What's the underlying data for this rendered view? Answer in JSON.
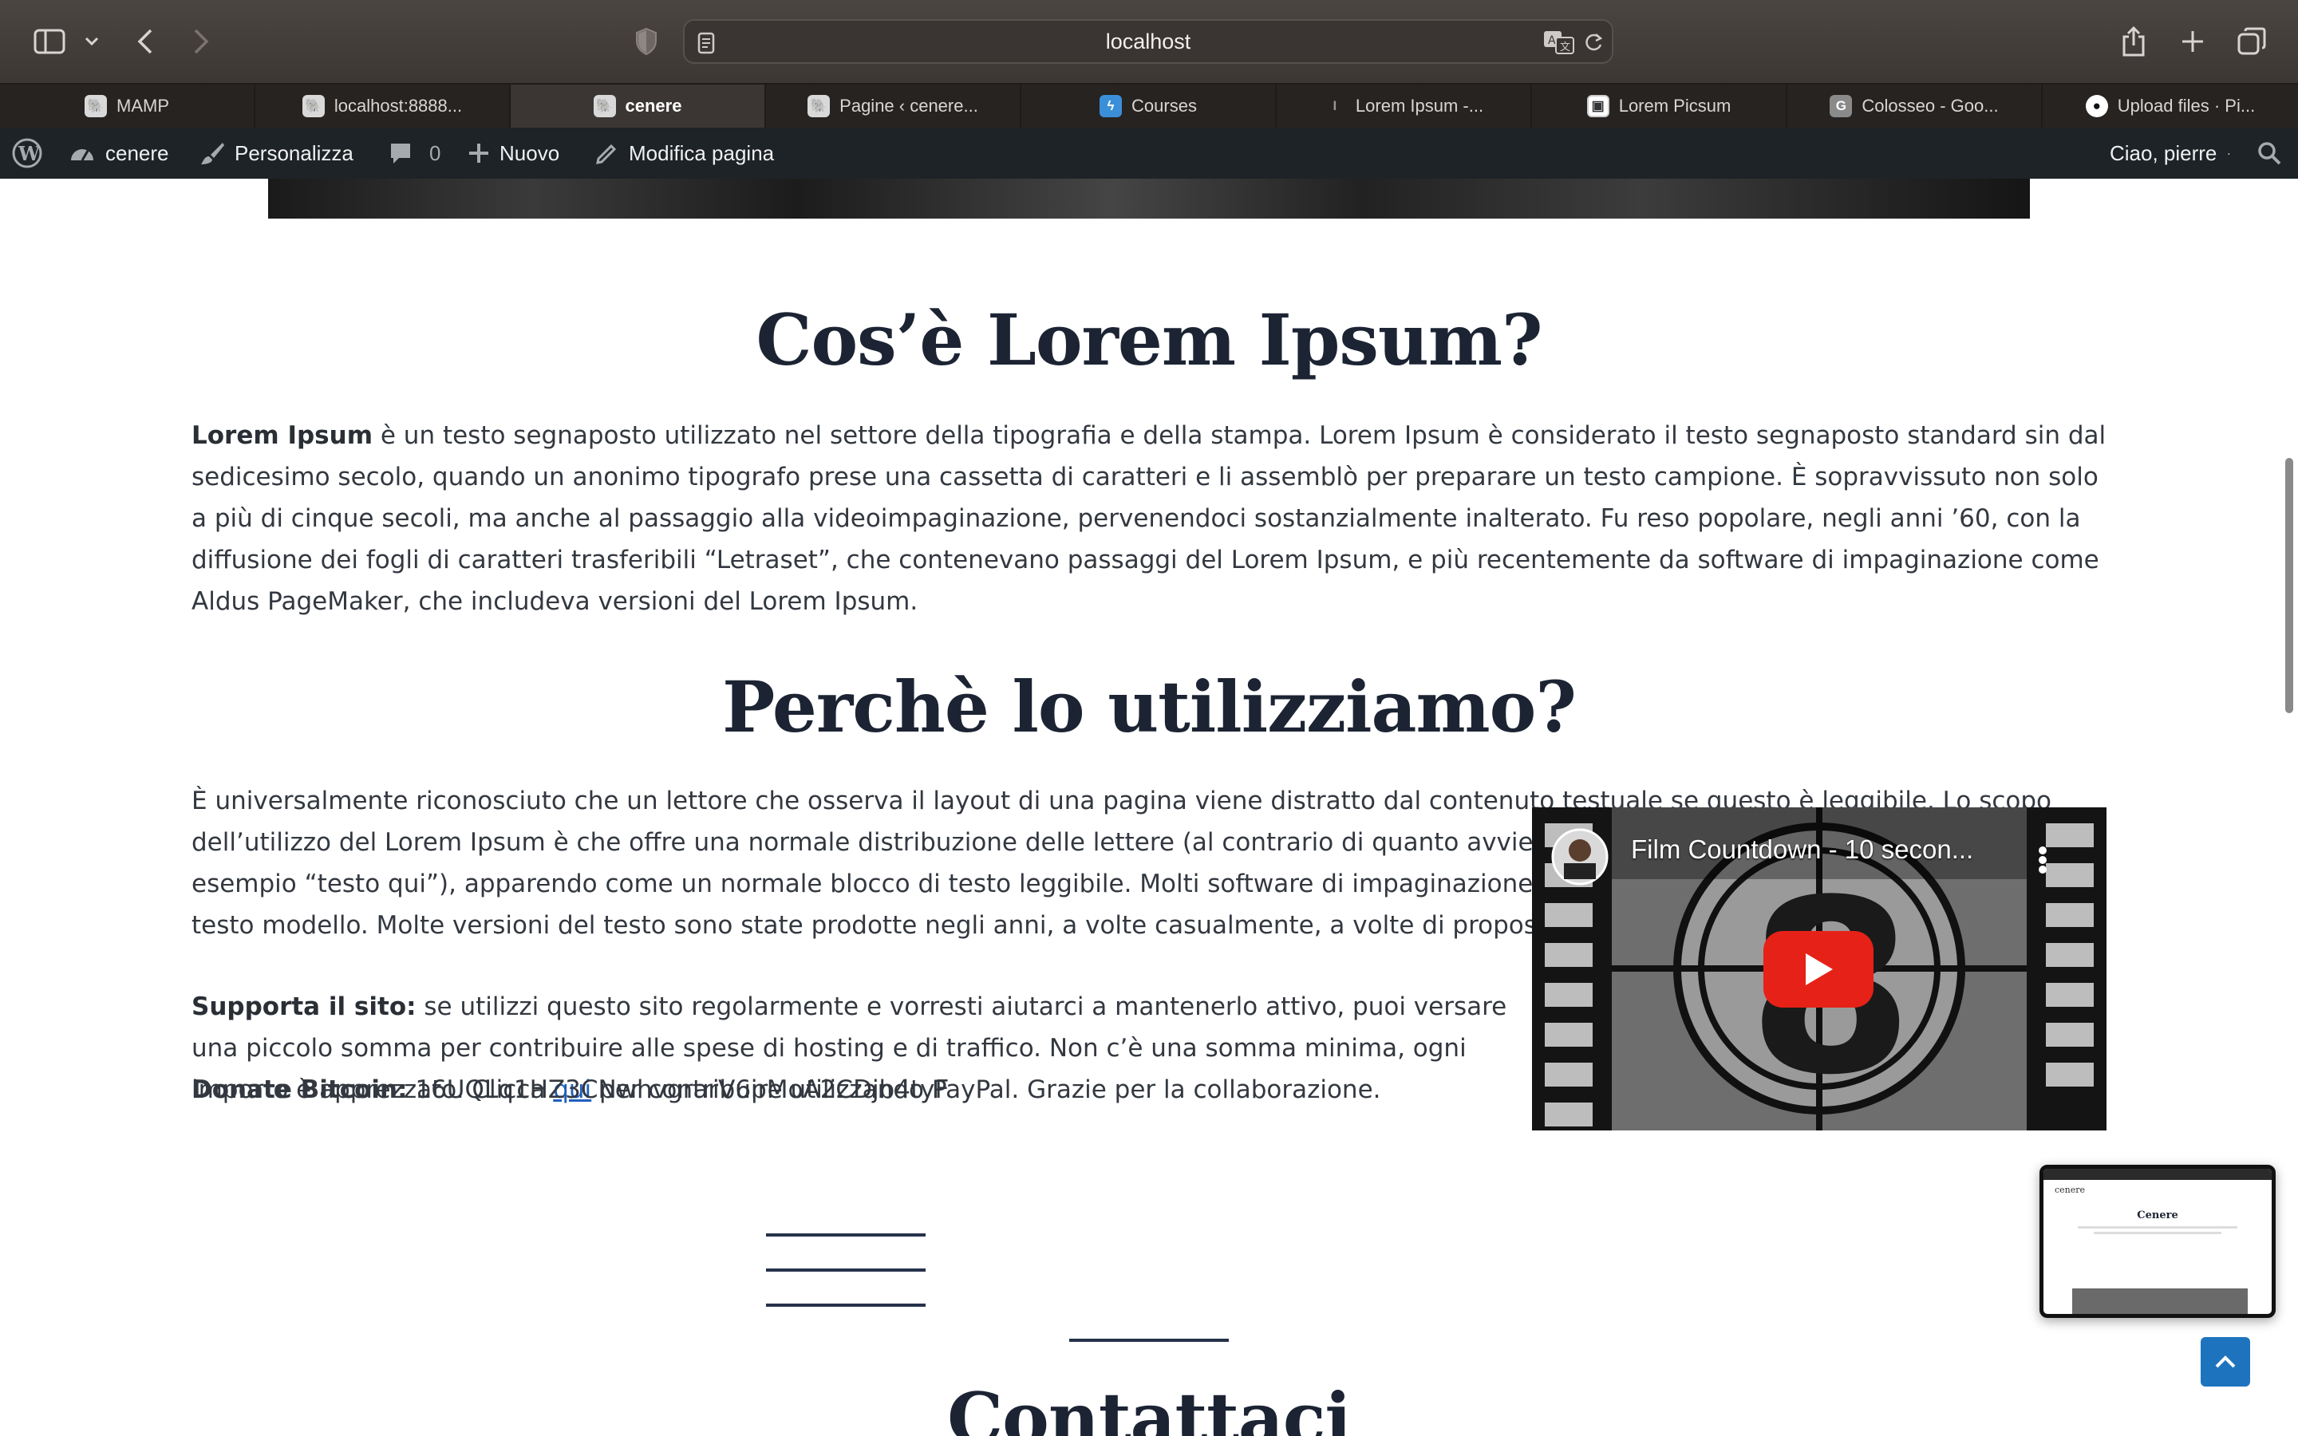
{
  "browser": {
    "url": "localhost",
    "tabs": [
      {
        "label": "MAMP",
        "icon": "mamp-elephant-icon",
        "active": false
      },
      {
        "label": "localhost:8888...",
        "icon": "mamp-elephant-icon",
        "active": false
      },
      {
        "label": "cenere",
        "icon": "mamp-elephant-icon",
        "active": true
      },
      {
        "label": "Pagine ‹ cenere...",
        "icon": "mamp-elephant-icon",
        "active": false
      },
      {
        "label": "Courses",
        "icon": "courses-icon",
        "active": false
      },
      {
        "label": "Lorem Ipsum -...",
        "icon": "lorem-ipsum-icon",
        "active": false
      },
      {
        "label": "Lorem Picsum",
        "icon": "picsum-icon",
        "active": false
      },
      {
        "label": "Colosseo - Goo...",
        "icon": "google-g-icon",
        "active": false
      },
      {
        "label": "Upload files · Pi...",
        "icon": "github-icon",
        "active": false
      }
    ]
  },
  "adminbar": {
    "site_name": "cenere",
    "customize": "Personalizza",
    "comments_count": "0",
    "new": "Nuovo",
    "edit_page": "Modifica pagina",
    "greeting": "Ciao, pierre"
  },
  "content": {
    "heading1": "Cos’è Lorem Ipsum?",
    "para1_bold": "Lorem Ipsum",
    "para1_rest": " è un testo segnaposto utilizzato nel settore della tipografia e della stampa. Lorem Ipsum è considerato il testo segnaposto standard sin dal sedicesimo secolo, quando un anonimo tipografo prese una cassetta di caratteri e li assemblò per preparare un testo campione. È sopravvissuto non solo a più di cinque secoli, ma anche al passaggio alla videoimpaginazione, pervenendoci sostanzialmente inalterato. Fu reso popolare, negli anni ’60, con la diffusione dei fogli di caratteri trasferibili “Letraset”, che contenevano passaggi del Lorem Ipsum, e più recentemente da software di impaginazione come Aldus PageMaker, che includeva versioni del Lorem Ipsum.",
    "heading2": "Perchè lo utilizziamo?",
    "para2": "È universalmente riconosciuto che un lettore che osserva il layout di una pagina viene distratto dal contenuto testuale se questo è leggibile. Lo scopo dell’utilizzo del Lorem Ipsum è che offre una normale distribuzione delle lettere (al contrario di quanto avviene se si utilizzano brevi frasi ripetute, ad esempio “testo qui”), apparendo come un normale blocco di testo leggibile. Molti software di impaginazione e di web design utilizzano Lorem Ipsum come testo modello. Molte versioni del testo sono state prodotte negli anni, a volte casualmente, a volte di proposito (ad esempio inserendo passaggi ironici).",
    "support_label": "Supporta il sito:",
    "support_text_1": " se utilizzi questo sito regolarmente e vorresti aiutarci a mantenerlo attivo, puoi versare una piccolo somma per contribuire alle spese di hosting e di traffico. Non c’è una somma minima, ogni importo è apprezzato. Clicca ",
    "support_link": "qui",
    "support_text_2": " per contribuire utilizzando PayPal. Grazie per la collaborazione.",
    "donate_label": "Donate Bitcoin:",
    "donate_address": " 16UQLq1HZ3CNwhvgrarV6pMoA2CDjb4tyF",
    "heading3": "Contattaci"
  },
  "video": {
    "title": "Film Countdown - 10 secon..."
  },
  "pip": {
    "site": "cenere",
    "title": "Cenere"
  },
  "colors": {
    "heading": "#1c2434",
    "link": "#1f5fbf",
    "adminbar": "#1d2327",
    "to_top": "#1e73be"
  }
}
